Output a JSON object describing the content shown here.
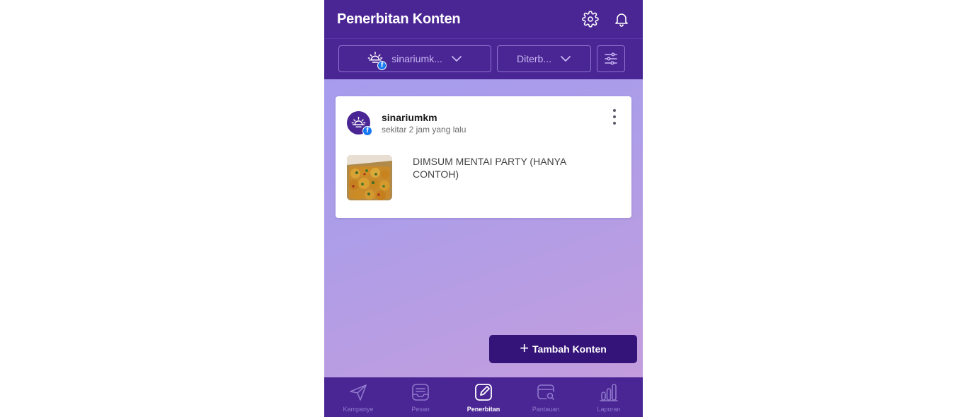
{
  "header": {
    "title": "Penerbitan Konten",
    "settings_icon": "gear-icon",
    "notification_icon": "bell-icon"
  },
  "filters": {
    "account_dropdown": {
      "label": "sinariumk...",
      "icon": "sun-logo-icon",
      "badge": "f"
    },
    "status_dropdown": {
      "label": "Diterb..."
    },
    "filter_button_icon": "sliders-icon"
  },
  "post": {
    "account_name": "sinariumkm",
    "time": "sekitar 2 jam yang lalu",
    "badge": "f",
    "text": "DIMSUM MENTAI PARTY (HANYA CONTOH)",
    "thumbnail": "dimsum-photo"
  },
  "add_button": {
    "label": "Tambah Konten"
  },
  "bottom_nav": {
    "items": [
      {
        "label": "Kampanye",
        "icon": "paper-plane-icon"
      },
      {
        "label": "Pesan",
        "icon": "inbox-icon"
      },
      {
        "label": "Penerbitan",
        "icon": "edit-icon"
      },
      {
        "label": "Pantauan",
        "icon": "monitor-icon"
      },
      {
        "label": "Laporan",
        "icon": "bar-chart-icon"
      }
    ],
    "active": "Penerbitan"
  },
  "colors": {
    "header_bg": "#4a2594",
    "button_bg": "#351479",
    "facebook_blue": "#1877f2",
    "gradient_start": "#a39bf0",
    "gradient_end": "#c79ddc"
  }
}
